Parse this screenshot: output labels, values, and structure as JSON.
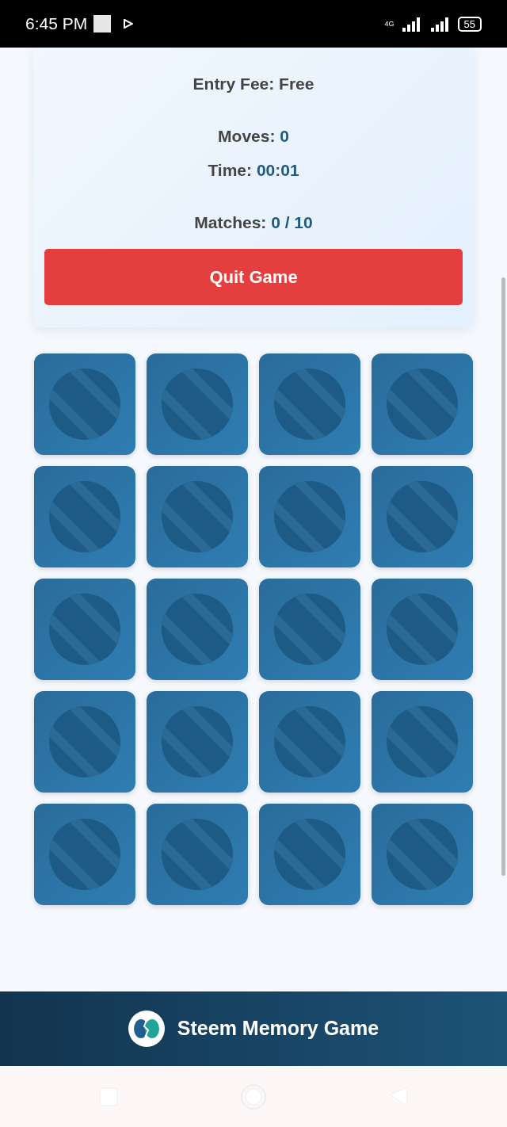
{
  "status_bar": {
    "time": "6:45 PM",
    "network": "4G",
    "battery": "55"
  },
  "info_card": {
    "entry_fee": "Entry Fee: Free",
    "stats": [
      {
        "label": "Moves:",
        "value": "0"
      },
      {
        "label": "Time:",
        "value": "00:01"
      },
      {
        "label": "Matches:",
        "value": "0 / 10"
      }
    ],
    "quit_button": "Quit Game"
  },
  "cards": [
    {
      "kind": "hidden"
    },
    {
      "kind": "hidden"
    },
    {
      "kind": "hidden"
    },
    {
      "kind": "hidden"
    },
    {
      "kind": "hidden"
    },
    {
      "kind": "hidden"
    },
    {
      "kind": "hidden"
    },
    {
      "kind": "hidden"
    },
    {
      "kind": "hidden"
    },
    {
      "kind": "hidden"
    },
    {
      "kind": "hidden"
    },
    {
      "kind": "hidden"
    },
    {
      "kind": "hidden"
    },
    {
      "kind": "hidden"
    },
    {
      "kind": "hidden"
    },
    {
      "kind": "hidden"
    },
    {
      "kind": "hidden"
    },
    {
      "kind": "hidden"
    },
    {
      "kind": "hidden"
    },
    {
      "kind": "hidden"
    }
  ],
  "footer": {
    "title": "Steem Memory Game"
  }
}
